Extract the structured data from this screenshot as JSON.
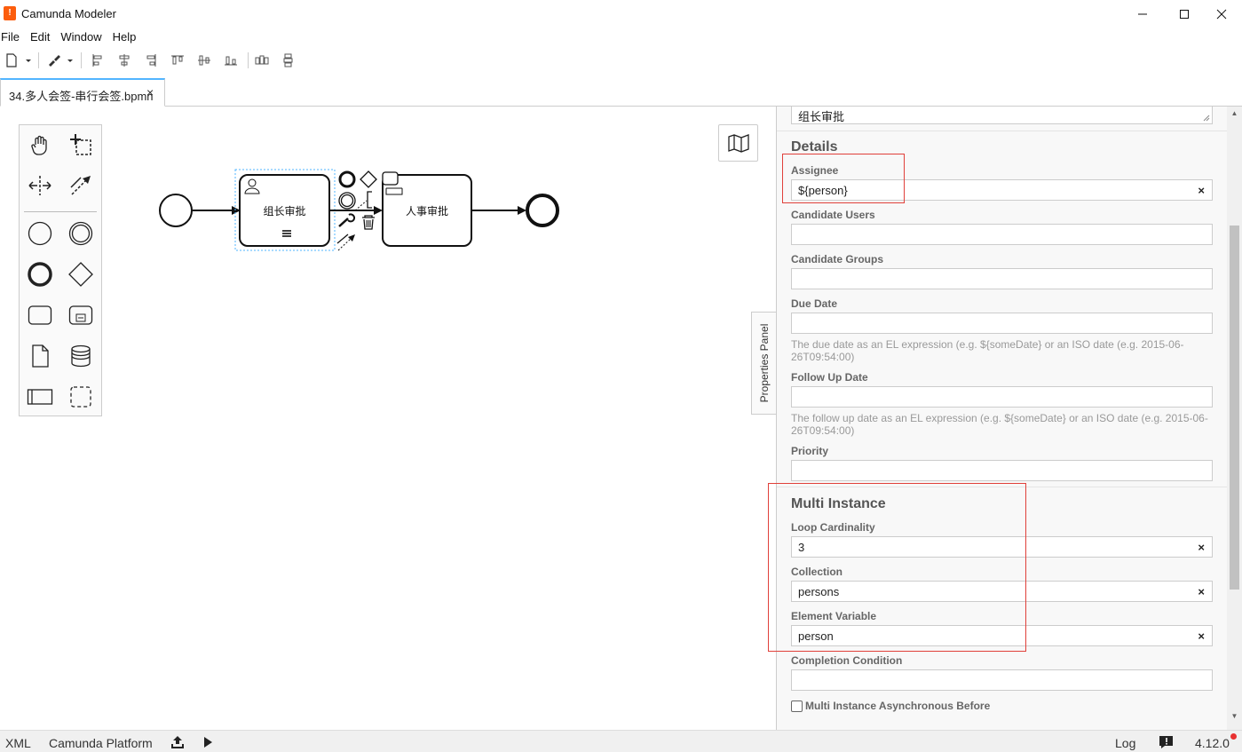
{
  "window": {
    "title": "Camunda Modeler",
    "app_icon_glyph": "!"
  },
  "menu": [
    "File",
    "Edit",
    "Window",
    "Help"
  ],
  "tab": {
    "label": "34.多人会签-串行会签.bpmn",
    "close_glyph": "×"
  },
  "diagram": {
    "task1_label": "组长审批",
    "task2_label": "人事审批"
  },
  "properties_panel": {
    "toggle_label": "Properties Panel",
    "name_value": "组长审批",
    "details_title": "Details",
    "assignee_label": "Assignee",
    "assignee_value": "${person}",
    "candidate_users_label": "Candidate Users",
    "candidate_users_value": "",
    "candidate_groups_label": "Candidate Groups",
    "candidate_groups_value": "",
    "due_date_label": "Due Date",
    "due_date_value": "",
    "due_date_desc": "The due date as an EL expression (e.g. ${someDate} or an ISO date (e.g. 2015-06-26T09:54:00)",
    "follow_up_label": "Follow Up Date",
    "follow_up_value": "",
    "follow_up_desc": "The follow up date as an EL expression (e.g. ${someDate} or an ISO date (e.g. 2015-06-26T09:54:00)",
    "priority_label": "Priority",
    "priority_value": "",
    "multi_instance_title": "Multi Instance",
    "loop_cardinality_label": "Loop Cardinality",
    "loop_cardinality_value": "3",
    "collection_label": "Collection",
    "collection_value": "persons",
    "element_variable_label": "Element Variable",
    "element_variable_value": "person",
    "completion_condition_label": "Completion Condition",
    "completion_condition_value": "",
    "async_before_label": "Multi Instance Asynchronous Before",
    "clear_glyph": "×"
  },
  "statusbar": {
    "xml": "XML",
    "platform": "Camunda Platform",
    "log": "Log",
    "version": "4.12.0"
  },
  "colors": {
    "accent": "#52b5ff",
    "highlight": "#e0403a",
    "brand": "#fc5d0d"
  }
}
